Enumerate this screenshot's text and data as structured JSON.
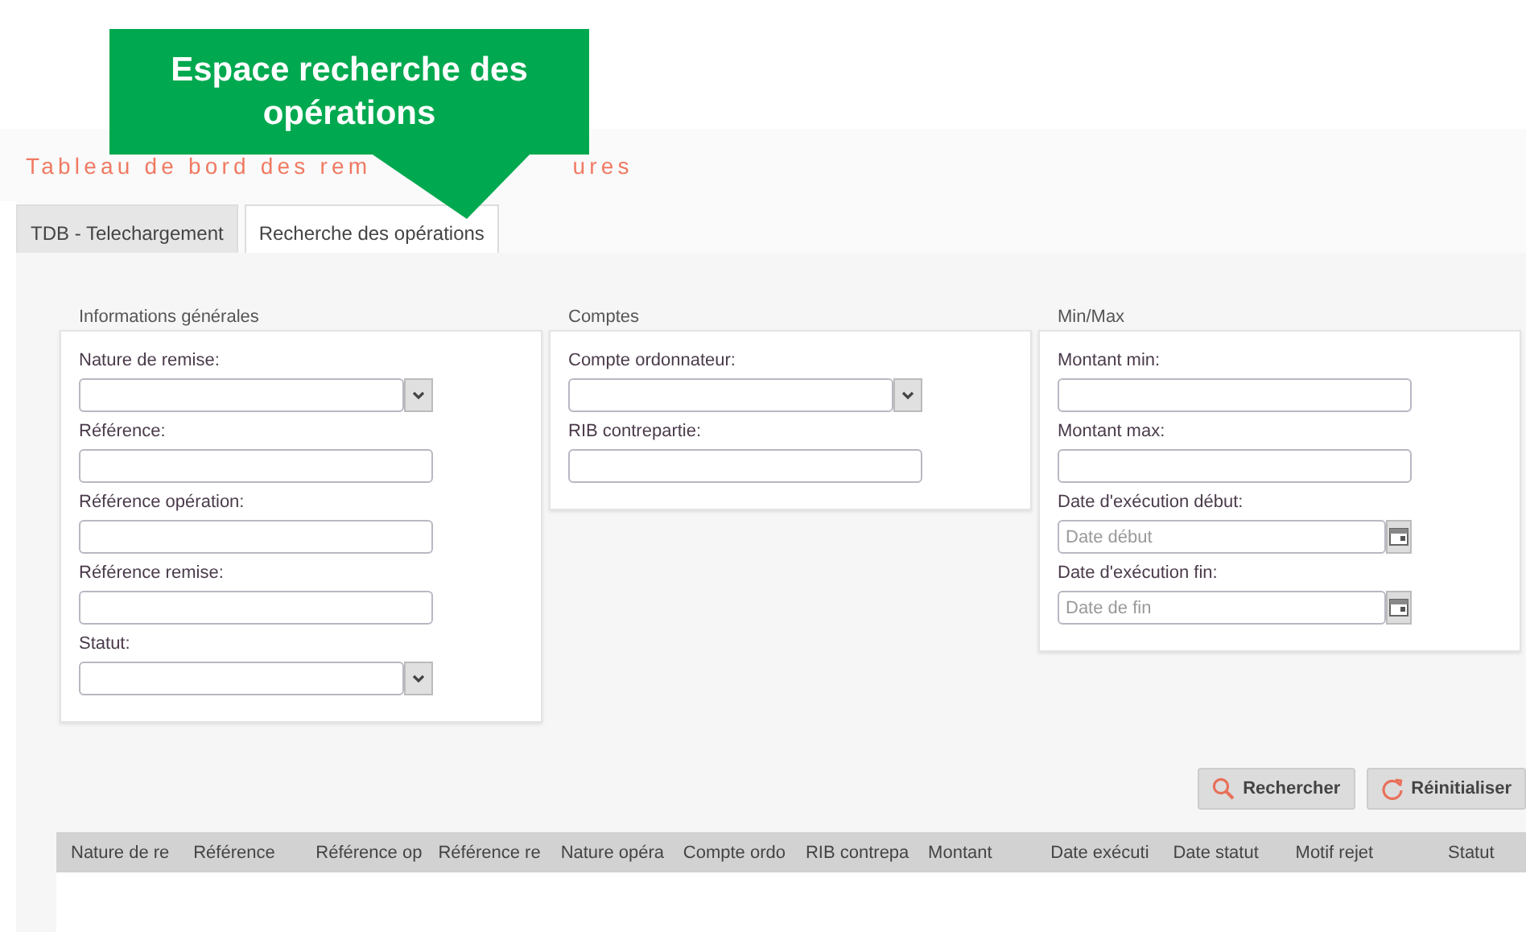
{
  "callout": {
    "text": "Espace recherche des opérations"
  },
  "title_parts": [
    "Tableau de bord des rem",
    "ures"
  ],
  "tabs": [
    {
      "label": "TDB - Telechargement",
      "selected": false
    },
    {
      "label": "Recherche des opérations",
      "selected": true
    }
  ],
  "groups": [
    {
      "legend": "Informations générales",
      "fields": [
        {
          "label": "Nature de remise:",
          "kind": "select"
        },
        {
          "label": "Référence:",
          "kind": "text"
        },
        {
          "label": "Référence opération:",
          "kind": "text"
        },
        {
          "label": "Référence remise:",
          "kind": "text"
        },
        {
          "label": "Statut:",
          "kind": "select"
        }
      ]
    },
    {
      "legend": "Comptes",
      "fields": [
        {
          "label": "Compte ordonnateur:",
          "kind": "select"
        },
        {
          "label": "RIB contrepartie:",
          "kind": "text"
        }
      ]
    },
    {
      "legend": "Min/Max",
      "fields": [
        {
          "label": "Montant min:",
          "kind": "text"
        },
        {
          "label": "Montant max:",
          "kind": "text"
        },
        {
          "label": "Date d'exécution début:",
          "kind": "date",
          "placeholder": "Date début"
        },
        {
          "label": "Date d'exécution fin:",
          "kind": "date",
          "placeholder": "Date de fin"
        }
      ]
    }
  ],
  "buttons": [
    {
      "label": "Rechercher",
      "kind": "search"
    },
    {
      "label": "Réinitialiser",
      "kind": "reset"
    }
  ],
  "table": {
    "columns": [
      "Nature de re",
      "Référence",
      "Référence op",
      "Référence re",
      "Nature opéra",
      "Compte ordo",
      "RIB contrepa",
      "Montant",
      "Date exécuti",
      "Date statut",
      "Motif rejet",
      "Statut"
    ]
  }
}
